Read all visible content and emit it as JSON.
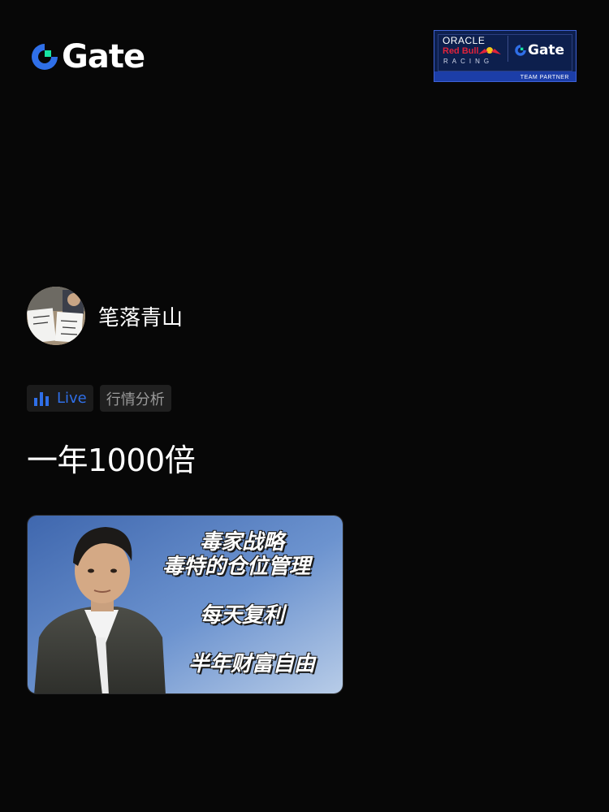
{
  "header": {
    "brand_name": "Gate",
    "brand_icon": "gate-logo-icon",
    "partner": {
      "line1": "ORACLE",
      "line2": "Red Bull",
      "line3": "RACING",
      "gate": "Gate",
      "footer": "TEAM PARTNER"
    }
  },
  "author": {
    "name": "笔落青山",
    "avatar_icon": "avatar-photo"
  },
  "tags": {
    "live_label": "Live",
    "live_icon": "bar-chart-icon",
    "topic_label": "行情分析"
  },
  "post": {
    "title": "一年1000倍"
  },
  "cover": {
    "line1": "毒家战略",
    "line2": "毒特的仓位管理",
    "line3": "每天复利",
    "line4": "半年财富自由"
  },
  "colors": {
    "background": "#070707",
    "accent_blue": "#2f6fe8",
    "gate_green": "#17e5a3",
    "tag_bg": "#1b1b1b",
    "tag_text": "#9a9a9a"
  }
}
